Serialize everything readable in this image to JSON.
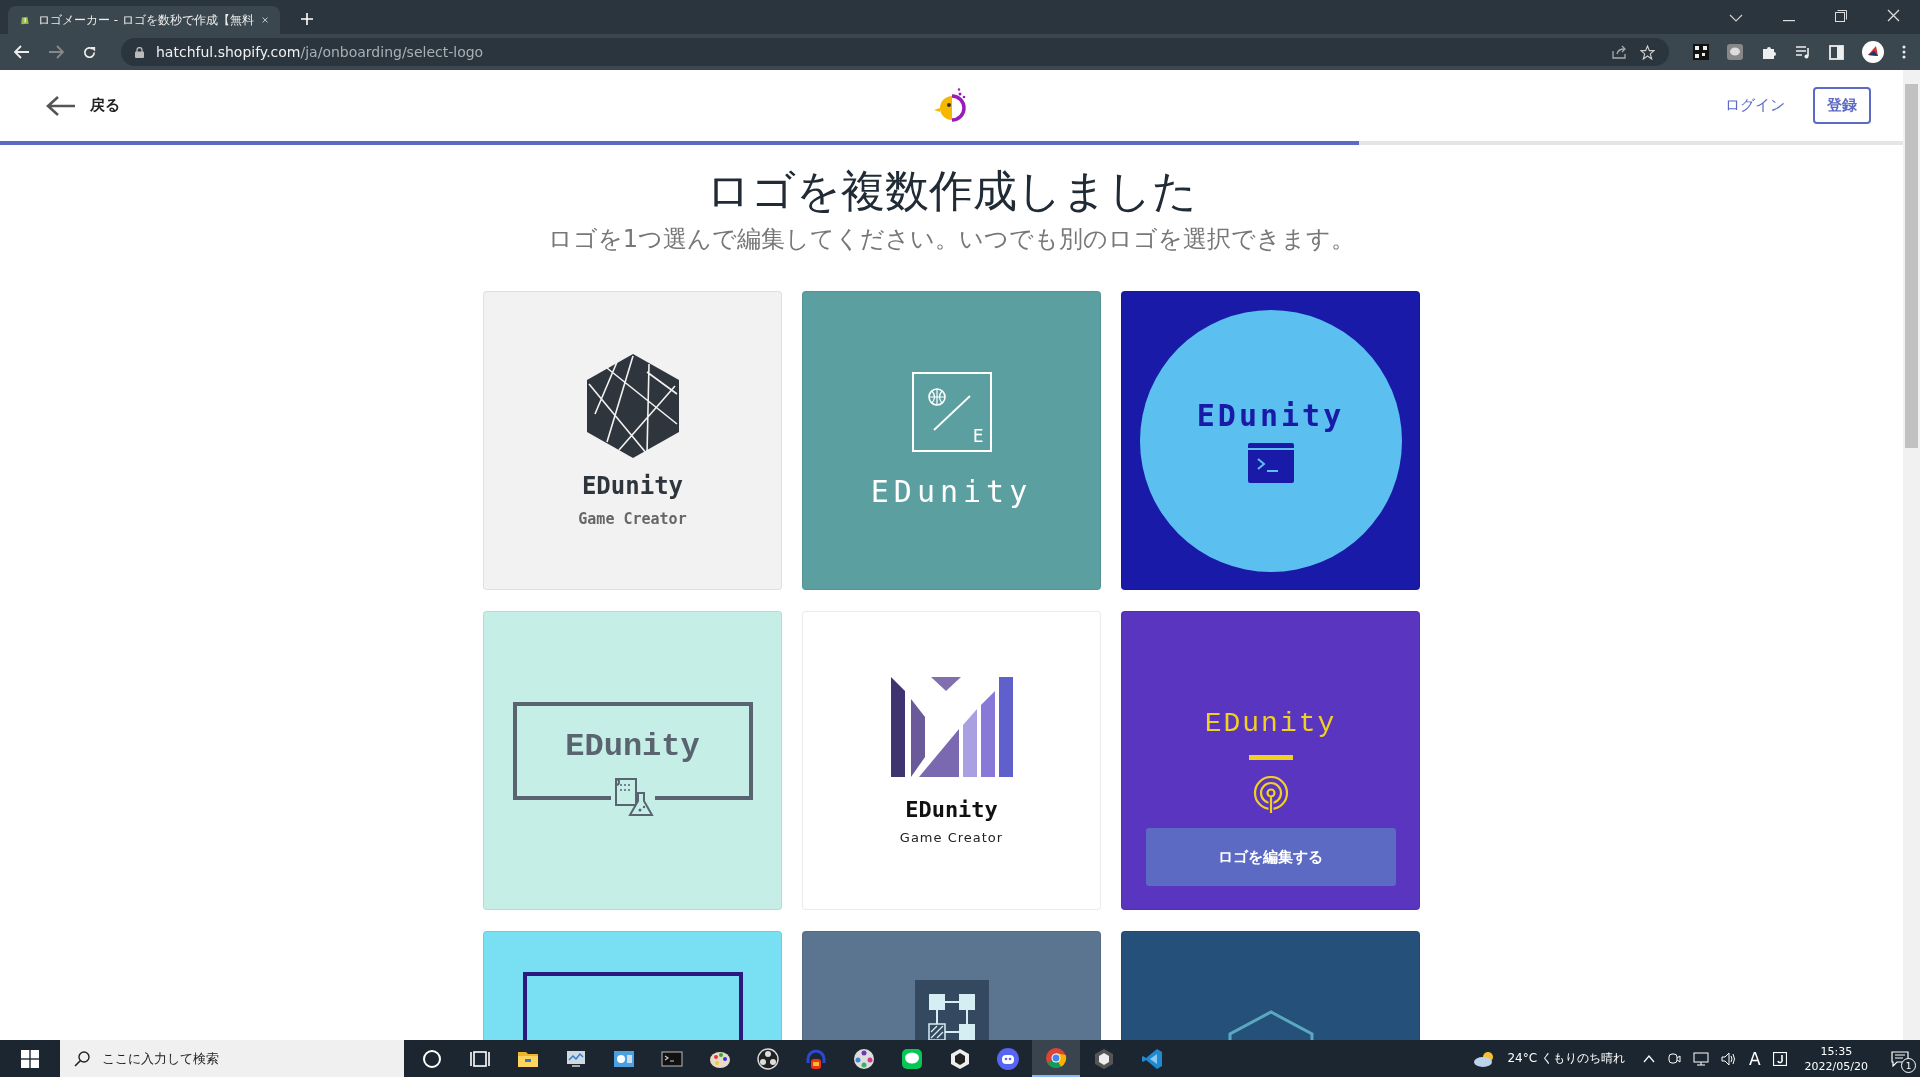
{
  "browser": {
    "tab_title": "ロゴメーカー - ロゴを数秒で作成【無料",
    "url_host": "hatchful.shopify.com",
    "url_path": "/ja/onboarding/select-logo"
  },
  "header": {
    "back": "戻る",
    "login": "ログイン",
    "register": "登録",
    "progress": {
      "level": 0.714
    }
  },
  "title": "ロゴを複数作成しました",
  "subtitle": "ロゴを1つ選んで編集してください。いつでも別のロゴを選択できます。",
  "cards": [
    {
      "kind": "hexagon",
      "color": "#f2f2f2",
      "name": "EDunity",
      "tagline": "Game Creator"
    },
    {
      "kind": "slash-box",
      "color": "#5c9fa0",
      "name": "EDunity",
      "letter": "E"
    },
    {
      "kind": "circle",
      "color": "#1a1aa8",
      "name": "EDunity"
    },
    {
      "kind": "frame-flask",
      "color": "#c5efe6",
      "name": "EDunity"
    },
    {
      "kind": "bars",
      "color": "#ffffff",
      "name": "EDunity",
      "tagline": "Game Creator"
    },
    {
      "kind": "antenna",
      "color": "#5a35c0",
      "name": "EDunity",
      "edit_button": "ロゴを編集する"
    },
    {
      "kind": "frame",
      "color": "#78e0f2"
    },
    {
      "kind": "nodes",
      "color": "#5b7590"
    },
    {
      "kind": "hex-outline",
      "color": "#24507a"
    }
  ],
  "taskbar": {
    "search_placeholder": "ここに入力して検索",
    "apps": [
      {
        "kind": "cortana",
        "active": false
      },
      {
        "kind": "taskview",
        "active": false
      },
      {
        "kind": "folder",
        "active": false
      },
      {
        "kind": "monitor",
        "active": false
      },
      {
        "kind": "control",
        "active": false
      },
      {
        "kind": "terminal",
        "active": false
      },
      {
        "kind": "paint",
        "active": false
      },
      {
        "kind": "obs",
        "active": false
      },
      {
        "kind": "audio",
        "active": false
      },
      {
        "kind": "film",
        "active": false
      },
      {
        "kind": "chat",
        "active": false
      },
      {
        "kind": "unity",
        "active": false
      },
      {
        "kind": "discord",
        "active": false
      },
      {
        "kind": "chrome",
        "active": true
      },
      {
        "kind": "cube",
        "active": false
      },
      {
        "kind": "vscode",
        "active": false
      }
    ],
    "weather": "24°C くもりのち晴れ",
    "ime": "A",
    "time": "15:35",
    "date": "2022/05/20",
    "notifications": "1"
  }
}
